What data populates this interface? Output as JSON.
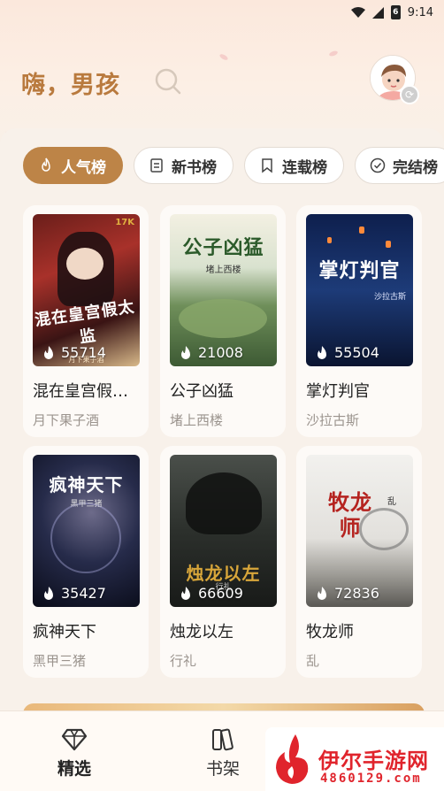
{
  "status_bar": {
    "time": "9:14",
    "battery": "6"
  },
  "header": {
    "greeting": "嗨，男孩"
  },
  "tabs": [
    {
      "label": "人气榜",
      "icon": "flame-icon",
      "active": true
    },
    {
      "label": "新书榜",
      "icon": "book-icon",
      "active": false
    },
    {
      "label": "连载榜",
      "icon": "bookmark-icon",
      "active": false
    },
    {
      "label": "完结榜",
      "icon": "check-circle-icon",
      "active": false
    }
  ],
  "books": [
    {
      "title": "混在皇宫假太监",
      "author": "月下果子酒",
      "hot": "55714",
      "cover_title": "混在皇宫假太监",
      "cover_badge": "17K",
      "cover_author": "月下果子酒"
    },
    {
      "title": "公子凶猛",
      "author": "堵上西楼",
      "hot": "21008",
      "cover_title": "公子凶猛",
      "cover_sub": "堵上西楼"
    },
    {
      "title": "掌灯判官",
      "author": "沙拉古斯",
      "hot": "55504",
      "cover_title": "掌灯判官",
      "cover_sub": "沙拉古斯"
    },
    {
      "title": "疯神天下",
      "author": "黑甲三猪",
      "hot": "35427",
      "cover_title": "疯神天下",
      "cover_sub": "黑甲三猪"
    },
    {
      "title": "烛龙以左",
      "author": "行礼",
      "hot": "66609",
      "cover_title": "烛龙以左",
      "cover_sub": "行礼"
    },
    {
      "title": "牧龙师",
      "author": "乱",
      "hot": "72836",
      "cover_title": "牧龙师",
      "cover_sub": "乱"
    }
  ],
  "bottom_nav": [
    {
      "label": "精选",
      "icon": "diamond-icon",
      "active": true
    },
    {
      "label": "书架",
      "icon": "bookshelf-icon",
      "active": false
    }
  ],
  "watermark": {
    "name": "伊尔手游网",
    "url": "4860129.com"
  },
  "colors": {
    "accent": "#bd8447",
    "greeting": "#b97a3e",
    "background": "#f8f1ea"
  }
}
